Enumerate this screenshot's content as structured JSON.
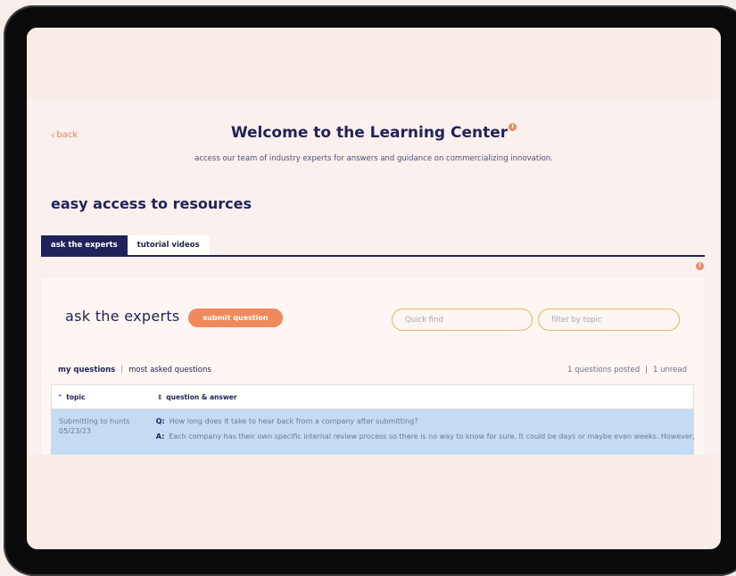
{
  "page": {
    "back_label": "back",
    "title": "Welcome to the Learning Center",
    "title_badge": "!",
    "subtitle": "access our team of industry experts for answers and guidance on commercializing innovation.",
    "section_title": "easy access to resources",
    "notice_badge": "!"
  },
  "tabs": [
    {
      "label": "ask the experts",
      "active": true
    },
    {
      "label": "tutorial videos",
      "active": false
    }
  ],
  "card": {
    "title": "ask the experts",
    "submit_label": "submit question",
    "quick_find_placeholder": "Quick find",
    "filter_placeholder": "filter by topic",
    "subnav": {
      "my_questions": "my questions",
      "separator": "|",
      "most_asked": "most asked questions"
    },
    "stats": {
      "posted": "1 questions posted",
      "separator": "|",
      "unread": "1 unread"
    }
  },
  "table": {
    "col_topic": "topic",
    "col_qa": "question & answer",
    "rows": [
      {
        "topic": "Submitting to hunts",
        "date": "05/23/23",
        "q_prefix": "Q:",
        "question": "How long does it take to hear back from a company after submitting?",
        "a_prefix": "A:",
        "answer": "Each company has their own specific internal review process so there is no way to know for sure. It could be days or maybe even weeks. However, i..."
      }
    ]
  },
  "colors": {
    "navy": "#20235a",
    "accent": "#f08a5d",
    "row_highlight": "#c4dcf3",
    "input_border": "#e4b860"
  },
  "icons": {
    "back": "chevron-left-icon",
    "sort_topic": "chevron-up-icon",
    "sort_qa": "sort-icon",
    "badge": "alert-badge-icon"
  }
}
